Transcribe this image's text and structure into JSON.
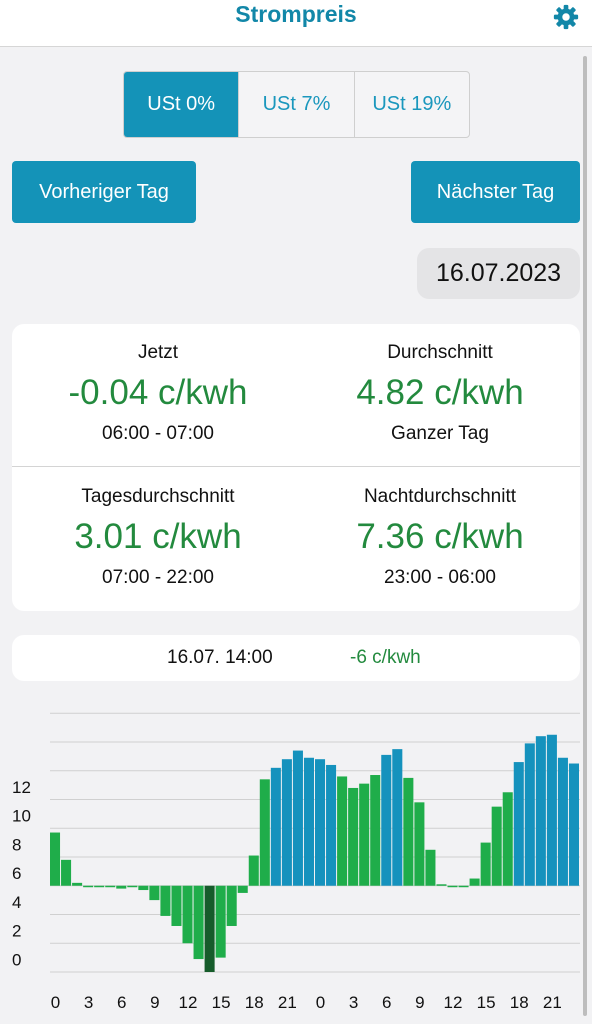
{
  "header": {
    "title": "Strompreis",
    "settings_icon": "gear-icon"
  },
  "tax_tabs": {
    "items": [
      {
        "label": "USt 0%",
        "active": true
      },
      {
        "label": "USt 7%",
        "active": false
      },
      {
        "label": "USt 19%",
        "active": false
      }
    ]
  },
  "nav": {
    "prev_label": "Vorheriger Tag",
    "next_label": "Nächster Tag"
  },
  "date": "16.07.2023",
  "stats": {
    "now": {
      "label": "Jetzt",
      "value": "-0.04 c/kwh",
      "sub": "06:00 - 07:00"
    },
    "average": {
      "label": "Durchschnitt",
      "value": "4.82 c/kwh",
      "sub": "Ganzer Tag"
    },
    "day_average": {
      "label": "Tagesdurchschnitt",
      "value": "3.01 c/kwh",
      "sub": "07:00 - 22:00"
    },
    "night_average": {
      "label": "Nachtdurchschnitt",
      "value": "7.36 c/kwh",
      "sub": "23:00 - 06:00"
    }
  },
  "selection": {
    "time": "16.07. 14:00",
    "price": "-6 c/kwh"
  },
  "colors": {
    "accent": "#1493b8",
    "price_green": "#238a3e",
    "bar_green": "#1fad4a",
    "bar_blue": "#1592bd",
    "bar_selected": "#165c2b"
  },
  "chart_data": {
    "type": "bar",
    "y_tick_labels": [
      "0",
      "2",
      "4",
      "6",
      "8",
      "10",
      "12"
    ],
    "ylim": [
      -6,
      12.5
    ],
    "x_tick_labels": [
      "0",
      "3",
      "6",
      "9",
      "12",
      "15",
      "18",
      "21",
      "0",
      "3",
      "6",
      "9",
      "12",
      "15",
      "18",
      "21"
    ],
    "grid": true,
    "selected_index": 14,
    "hours": [
      0,
      1,
      2,
      3,
      4,
      5,
      6,
      7,
      8,
      9,
      10,
      11,
      12,
      13,
      14,
      15,
      16,
      17,
      18,
      19,
      20,
      21,
      22,
      23,
      0,
      1,
      2,
      3,
      4,
      5,
      6,
      7,
      8,
      9,
      10,
      11,
      12,
      13,
      14,
      15,
      16,
      17,
      18,
      19,
      20,
      21,
      22,
      23
    ],
    "values": [
      3.7,
      1.8,
      0.2,
      0.0,
      0.0,
      -0.04,
      -0.2,
      -0.1,
      -0.3,
      -1.0,
      -2.1,
      -2.8,
      -4.0,
      -5.1,
      -6.0,
      -5.0,
      -2.8,
      -0.5,
      2.1,
      7.4,
      8.2,
      8.8,
      9.4,
      8.9,
      8.8,
      8.4,
      7.6,
      6.8,
      7.1,
      7.7,
      9.1,
      9.5,
      7.5,
      5.8,
      2.5,
      0.1,
      0.0,
      0.0,
      0.5,
      3.0,
      5.5,
      6.5,
      8.6,
      9.9,
      10.4,
      10.5,
      8.9,
      8.5
    ],
    "colors_by_bar": [
      "g",
      "g",
      "g",
      "g",
      "g",
      "g",
      "g",
      "g",
      "g",
      "g",
      "g",
      "g",
      "g",
      "g",
      "s",
      "g",
      "g",
      "g",
      "g",
      "g",
      "b",
      "b",
      "b",
      "b",
      "b",
      "b",
      "g",
      "g",
      "g",
      "g",
      "b",
      "b",
      "g",
      "g",
      "g",
      "g",
      "g",
      "g",
      "g",
      "g",
      "g",
      "g",
      "b",
      "b",
      "b",
      "b",
      "b",
      "b"
    ]
  }
}
